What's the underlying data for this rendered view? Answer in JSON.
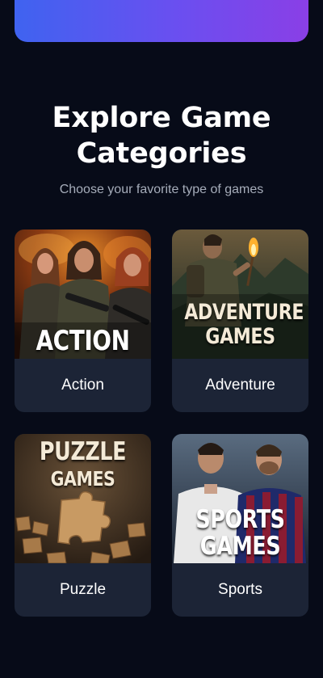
{
  "page": {
    "title": "Explore Game Categories",
    "subtitle": "Choose your favorite type of games"
  },
  "categories": [
    {
      "label": "Action",
      "art_title": "ACTION",
      "art_subtitle": "",
      "icon": "action-art-icon"
    },
    {
      "label": "Adventure",
      "art_title": "ADVENTURE",
      "art_subtitle": "GAMES",
      "icon": "adventure-art-icon"
    },
    {
      "label": "Puzzle",
      "art_title": "PUZZLE",
      "art_subtitle": "GAMES",
      "icon": "puzzle-art-icon"
    },
    {
      "label": "Sports",
      "art_title": "SPORTS",
      "art_subtitle": "GAMES",
      "icon": "sports-art-icon"
    }
  ],
  "colors": {
    "background": "#070b18",
    "card": "#1c2436",
    "gradient_start": "#3f63f0",
    "gradient_end": "#8a3fe6",
    "subtitle": "#a6adba"
  }
}
